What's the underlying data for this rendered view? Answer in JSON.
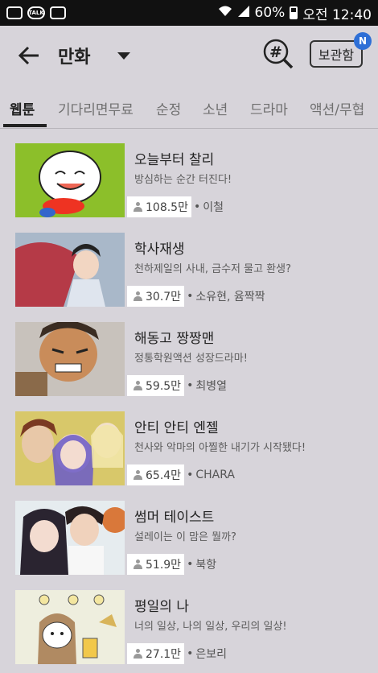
{
  "status": {
    "talk_label": "TALK",
    "battery": "60%",
    "time": "오전 12:40"
  },
  "header": {
    "title": "만화",
    "vault_label": "보관함",
    "badge": "N"
  },
  "tabs": [
    "웹툰",
    "기다리면무료",
    "순정",
    "소년",
    "드라마",
    "액션/무협"
  ],
  "items": [
    {
      "title": "오늘부터 찰리",
      "desc": "방심하는 순간 터진다!",
      "views": "108.5만",
      "author": "이철"
    },
    {
      "title": "학사재생",
      "desc": "천하제일의 사내, 금수저 물고 환생?",
      "views": "30.7만",
      "author": "소유현, 윰짝짝"
    },
    {
      "title": "해동고 짱짱맨",
      "desc": "정통학원액션 성장드라마!",
      "views": "59.5만",
      "author": "최병열"
    },
    {
      "title": "안티 안티 엔젤",
      "desc": "천사와 악마의 아찔한 내기가 시작됐다!",
      "views": "65.4만",
      "author": "CHARA"
    },
    {
      "title": "썸머 테이스트",
      "desc": "설레이는 이 맘은 뭘까?",
      "views": "51.9만",
      "author": "북항"
    },
    {
      "title": "평일의 나",
      "desc": "너의 일상, 나의 일상, 우리의 일상!",
      "views": "27.1만",
      "author": "은보리"
    }
  ]
}
